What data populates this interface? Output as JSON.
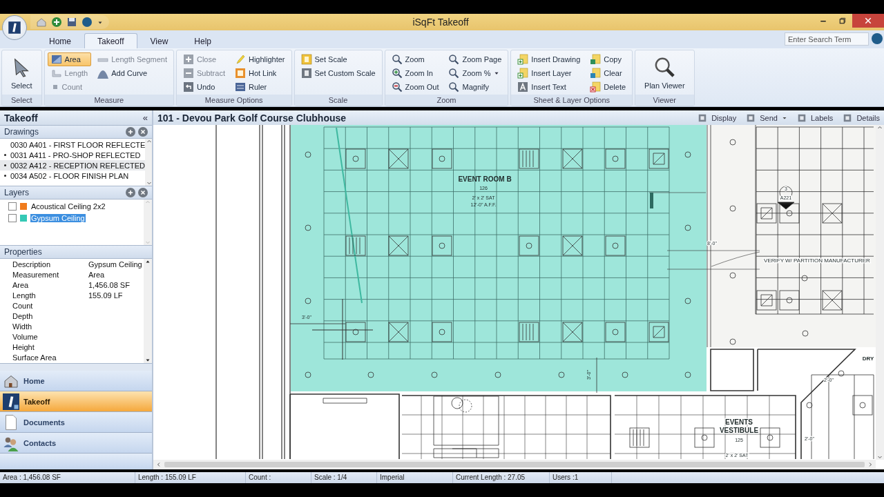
{
  "window": {
    "title": "iSqFt Takeoff"
  },
  "tabs": [
    {
      "label": "Home",
      "selected": false
    },
    {
      "label": "Takeoff",
      "selected": true
    },
    {
      "label": "View",
      "selected": false
    },
    {
      "label": "Help",
      "selected": false
    }
  ],
  "search": {
    "placeholder": "Enter Search Term"
  },
  "ribbon": [
    {
      "label": "Select",
      "items": [
        {
          "label": "Select",
          "kind": "large",
          "selected": false,
          "disabled": false
        }
      ]
    },
    {
      "label": "Measure",
      "items": [
        {
          "label": "Area",
          "kind": "small",
          "selected": true,
          "disabled": false
        },
        {
          "label": "Length",
          "kind": "small",
          "selected": false,
          "disabled": true
        },
        {
          "label": "Count",
          "kind": "small",
          "selected": false,
          "disabled": true
        },
        {
          "label": "Length Segment",
          "kind": "small",
          "selected": false,
          "disabled": true
        },
        {
          "label": "Add Curve",
          "kind": "small",
          "selected": false,
          "disabled": false
        }
      ]
    },
    {
      "label": "Measure Options",
      "items": [
        {
          "label": "Close",
          "kind": "small",
          "selected": false,
          "disabled": true
        },
        {
          "label": "Subtract",
          "kind": "small",
          "selected": false,
          "disabled": true
        },
        {
          "label": "Undo",
          "kind": "small",
          "selected": false,
          "disabled": false
        },
        {
          "label": "Highlighter",
          "kind": "small",
          "selected": false,
          "disabled": false
        },
        {
          "label": "Hot Link",
          "kind": "small",
          "selected": false,
          "disabled": false
        },
        {
          "label": "Ruler",
          "kind": "small",
          "selected": false,
          "disabled": false
        }
      ]
    },
    {
      "label": "Scale",
      "items": [
        {
          "label": "Set Scale",
          "kind": "small",
          "selected": false,
          "disabled": false
        },
        {
          "label": "Set Custom Scale",
          "kind": "small",
          "selected": false,
          "disabled": false
        }
      ]
    },
    {
      "label": "Zoom",
      "items": [
        {
          "label": "Zoom",
          "kind": "small",
          "selected": false,
          "disabled": false
        },
        {
          "label": "Zoom In",
          "kind": "small",
          "selected": false,
          "disabled": false
        },
        {
          "label": "Zoom Out",
          "kind": "small",
          "selected": false,
          "disabled": false
        },
        {
          "label": "Zoom Page",
          "kind": "small",
          "selected": false,
          "disabled": false
        },
        {
          "label": "Zoom %",
          "kind": "dropdown",
          "selected": false,
          "disabled": false
        },
        {
          "label": "Magnify",
          "kind": "small",
          "selected": false,
          "disabled": false
        }
      ]
    },
    {
      "label": "Sheet & Layer Options",
      "items": [
        {
          "label": "Insert Drawing",
          "kind": "small",
          "selected": false,
          "disabled": false
        },
        {
          "label": "Insert Layer",
          "kind": "small",
          "selected": false,
          "disabled": false
        },
        {
          "label": "Insert Text",
          "kind": "small",
          "selected": false,
          "disabled": false
        },
        {
          "label": "Copy",
          "kind": "small",
          "selected": false,
          "disabled": false
        },
        {
          "label": "Clear",
          "kind": "small",
          "selected": false,
          "disabled": false
        },
        {
          "label": "Delete",
          "kind": "small",
          "selected": false,
          "disabled": false
        }
      ]
    },
    {
      "label": "Viewer",
      "items": [
        {
          "label": "Plan Viewer",
          "kind": "large",
          "selected": false,
          "disabled": false
        }
      ]
    }
  ],
  "panel": {
    "title": "Takeoff",
    "collapse": "«"
  },
  "drawings": {
    "title": "Drawings",
    "items": [
      {
        "label": "0030 A401 - FIRST FLOOR REFLECTE",
        "bullet": false,
        "selected": false
      },
      {
        "label": "0031 A411 - PRO-SHOP REFLECTED",
        "bullet": true,
        "selected": false
      },
      {
        "label": "0032 A412 - RECEPTION REFLECTED",
        "bullet": true,
        "selected": true
      },
      {
        "label": "0034 A502 - FLOOR FINISH PLAN",
        "bullet": true,
        "selected": false
      }
    ]
  },
  "layers": {
    "title": "Layers",
    "items": [
      {
        "name": "Acoustical Ceiling 2x2",
        "color": "#f07b1c",
        "checked": false,
        "selected": false
      },
      {
        "name": "Gypsum Ceiling",
        "color": "#35c9b5",
        "checked": false,
        "selected": true
      }
    ]
  },
  "properties": {
    "title": "Properties",
    "rows": [
      {
        "name": "Description",
        "value": "Gypsum Ceiling"
      },
      {
        "name": "Measurement",
        "value": "Area"
      },
      {
        "name": "Area",
        "value": "1,456.08 SF"
      },
      {
        "name": "Length",
        "value": "155.09 LF"
      },
      {
        "name": "Count"
      },
      {
        "name": "Depth"
      },
      {
        "name": "Width"
      },
      {
        "name": "Volume"
      },
      {
        "name": "Height"
      },
      {
        "name": "Surface Area"
      }
    ]
  },
  "nav": [
    {
      "label": "Home",
      "selected": false
    },
    {
      "label": "Takeoff",
      "selected": true
    },
    {
      "label": "Documents",
      "selected": false
    },
    {
      "label": "Contacts",
      "selected": false
    }
  ],
  "document": {
    "title": "101 - Devou Park Golf Course Clubhouse",
    "actions": [
      {
        "label": "Display",
        "dropdown": false
      },
      {
        "label": "Send",
        "dropdown": true
      },
      {
        "label": "Labels",
        "dropdown": false
      },
      {
        "label": "Details",
        "dropdown": false
      }
    ]
  },
  "plan_labels": [
    "EVENT ROOM B",
    "126",
    "2' x 2' SAT",
    "12'-0\" A.F.F.",
    "3",
    "A221",
    "8'-0\"",
    "VERIFY W/ PARTITION MANUFACTURER",
    "3'-0\"",
    "3'-0\"",
    "DRY",
    "2'-0\"",
    "EVENTS",
    "VESTIBULE",
    "125",
    "2' x 2' SAT",
    "2'-0\""
  ],
  "status_bar": [
    "Area : 1,456.08 SF",
    "Length : 155.09 LF",
    "Count :",
    "Scale : 1/4",
    "Imperial",
    "Current Length : 27.05",
    "Users :1"
  ]
}
